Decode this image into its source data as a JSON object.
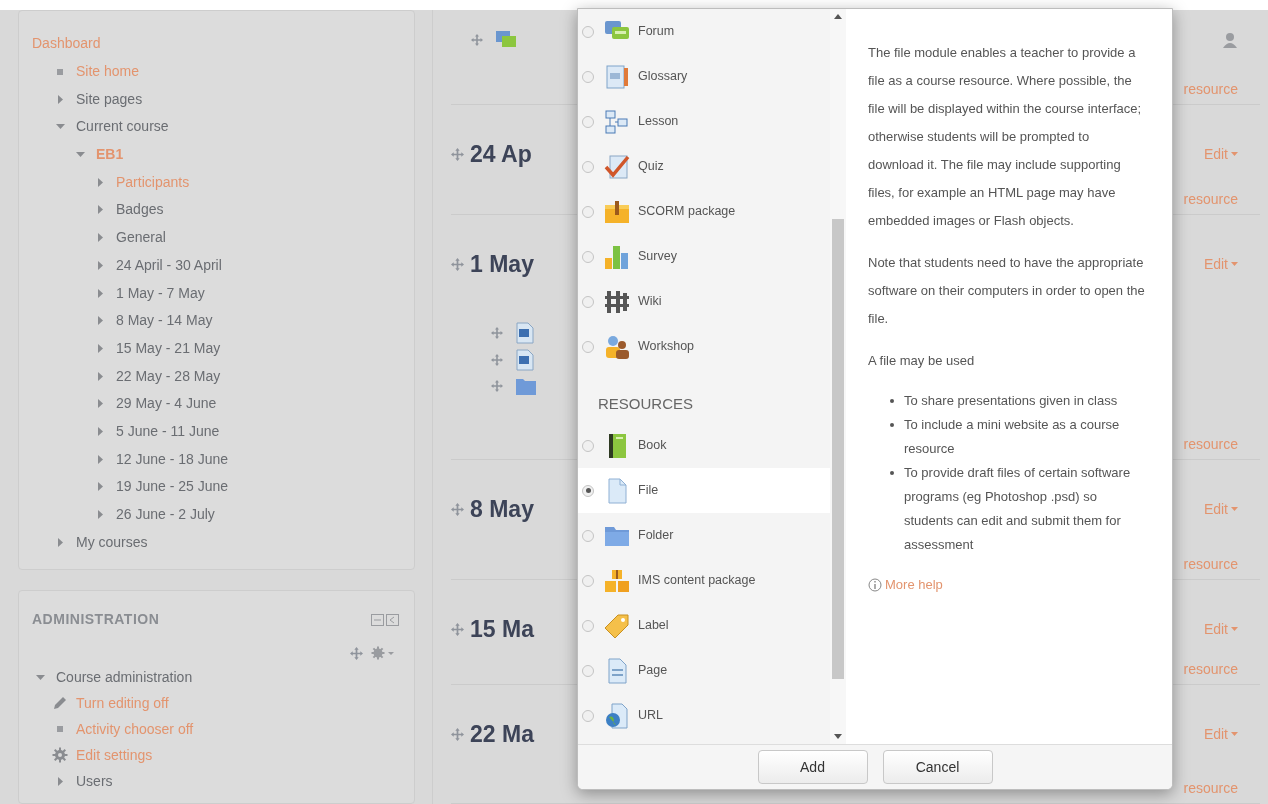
{
  "navigation": {
    "items": [
      {
        "label": "Dashboard",
        "highlighted": true,
        "selected": false,
        "children": [
          {
            "label": "Site home",
            "kind": "leaf",
            "highlighted": true,
            "selected": false
          },
          {
            "label": "Site pages",
            "kind": "branch",
            "expanded": false,
            "highlighted": false,
            "selected": false
          },
          {
            "label": "Current course",
            "kind": "branch",
            "expanded": true,
            "highlighted": false,
            "selected": false,
            "children": [
              {
                "label": "EB1",
                "kind": "branch",
                "expanded": true,
                "highlighted": true,
                "selected": true,
                "children": [
                  {
                    "label": "Participants",
                    "kind": "branch",
                    "expanded": false,
                    "highlighted": true,
                    "selected": false
                  },
                  {
                    "label": "Badges",
                    "kind": "branch",
                    "expanded": false,
                    "highlighted": false,
                    "selected": false
                  },
                  {
                    "label": "General",
                    "kind": "branch",
                    "expanded": false,
                    "highlighted": false,
                    "selected": false
                  },
                  {
                    "label": "24 April - 30 April",
                    "kind": "branch",
                    "expanded": false,
                    "highlighted": false,
                    "selected": false
                  },
                  {
                    "label": "1 May - 7 May",
                    "kind": "branch",
                    "expanded": false,
                    "highlighted": false,
                    "selected": false
                  },
                  {
                    "label": "8 May - 14 May",
                    "kind": "branch",
                    "expanded": false,
                    "highlighted": false,
                    "selected": false
                  },
                  {
                    "label": "15 May - 21 May",
                    "kind": "branch",
                    "expanded": false,
                    "highlighted": false,
                    "selected": false
                  },
                  {
                    "label": "22 May - 28 May",
                    "kind": "branch",
                    "expanded": false,
                    "highlighted": false,
                    "selected": false
                  },
                  {
                    "label": "29 May - 4 June",
                    "kind": "branch",
                    "expanded": false,
                    "highlighted": false,
                    "selected": false
                  },
                  {
                    "label": "5 June - 11 June",
                    "kind": "branch",
                    "expanded": false,
                    "highlighted": false,
                    "selected": false
                  },
                  {
                    "label": "12 June - 18 June",
                    "kind": "branch",
                    "expanded": false,
                    "highlighted": false,
                    "selected": false
                  },
                  {
                    "label": "19 June - 25 June",
                    "kind": "branch",
                    "expanded": false,
                    "highlighted": false,
                    "selected": false
                  },
                  {
                    "label": "26 June - 2 July",
                    "kind": "branch",
                    "expanded": false,
                    "highlighted": false,
                    "selected": false
                  }
                ]
              }
            ]
          },
          {
            "label": "My courses",
            "kind": "branch",
            "expanded": false,
            "highlighted": false,
            "selected": false
          }
        ]
      }
    ]
  },
  "administration": {
    "title": "ADMINISTRATION",
    "items": [
      {
        "label": "Course administration",
        "kind": "branch",
        "expanded": true,
        "highlighted": false,
        "selected": false,
        "children": [
          {
            "label": "Turn editing off",
            "kind": "tool",
            "highlighted": true,
            "selected": false
          },
          {
            "label": "Activity chooser off",
            "kind": "leaf",
            "highlighted": true,
            "selected": false
          },
          {
            "label": "Edit settings",
            "kind": "tool",
            "highlighted": true,
            "selected": false
          },
          {
            "label": "Users",
            "kind": "branch",
            "expanded": false,
            "highlighted": false,
            "selected": false
          }
        ]
      }
    ]
  },
  "sections": [
    {
      "link": "resource"
    },
    {
      "heading": "24 Ap",
      "edit": "Edit",
      "link": "resource"
    },
    {
      "heading": "1 May",
      "edit": "Edit",
      "link": "resource"
    },
    {
      "heading": "8 May",
      "edit": "Edit",
      "link": "resource"
    },
    {
      "heading": "15 Ma",
      "edit": "Edit",
      "link": "resource"
    },
    {
      "heading": "22 Ma",
      "edit": "Edit",
      "link": "resource"
    }
  ],
  "chooser": {
    "options": [
      {
        "kind": "option",
        "label": "Forum",
        "selected": false
      },
      {
        "kind": "option",
        "label": "Glossary",
        "selected": false
      },
      {
        "kind": "option",
        "label": "Lesson",
        "selected": false
      },
      {
        "kind": "option",
        "label": "Quiz",
        "selected": false
      },
      {
        "kind": "option",
        "label": "SCORM package",
        "selected": false
      },
      {
        "kind": "option",
        "label": "Survey",
        "selected": false
      },
      {
        "kind": "option",
        "label": "Wiki",
        "selected": false
      },
      {
        "kind": "option",
        "label": "Workshop",
        "selected": false
      },
      {
        "kind": "heading",
        "label": "RESOURCES"
      },
      {
        "kind": "option",
        "label": "Book",
        "selected": false
      },
      {
        "kind": "option",
        "label": "File",
        "selected": true
      },
      {
        "kind": "option",
        "label": "Folder",
        "selected": false
      },
      {
        "kind": "option",
        "label": "IMS content package",
        "selected": false
      },
      {
        "kind": "option",
        "label": "Label",
        "selected": false
      },
      {
        "kind": "option",
        "label": "Page",
        "selected": false
      },
      {
        "kind": "option",
        "label": "URL",
        "selected": false
      }
    ],
    "help": {
      "paragraphs": [
        "The file module enables a teacher to provide a file as a course resource. Where possible, the file will be displayed within the course interface; otherwise students will be prompted to download it. The file may include supporting files, for example an HTML page may have embedded images or Flash objects.",
        "Note that students need to have the appropriate software on their computers in order to open the file.",
        "A file may be used"
      ],
      "bullets": [
        "To share presentations given in class",
        "To include a mini website as a course resource",
        "To provide draft files of certain software programs (eg Photoshop .psd) so students can edit and submit them for assessment"
      ],
      "more_help": "More help"
    },
    "buttons": [
      "Add",
      "Cancel"
    ]
  }
}
